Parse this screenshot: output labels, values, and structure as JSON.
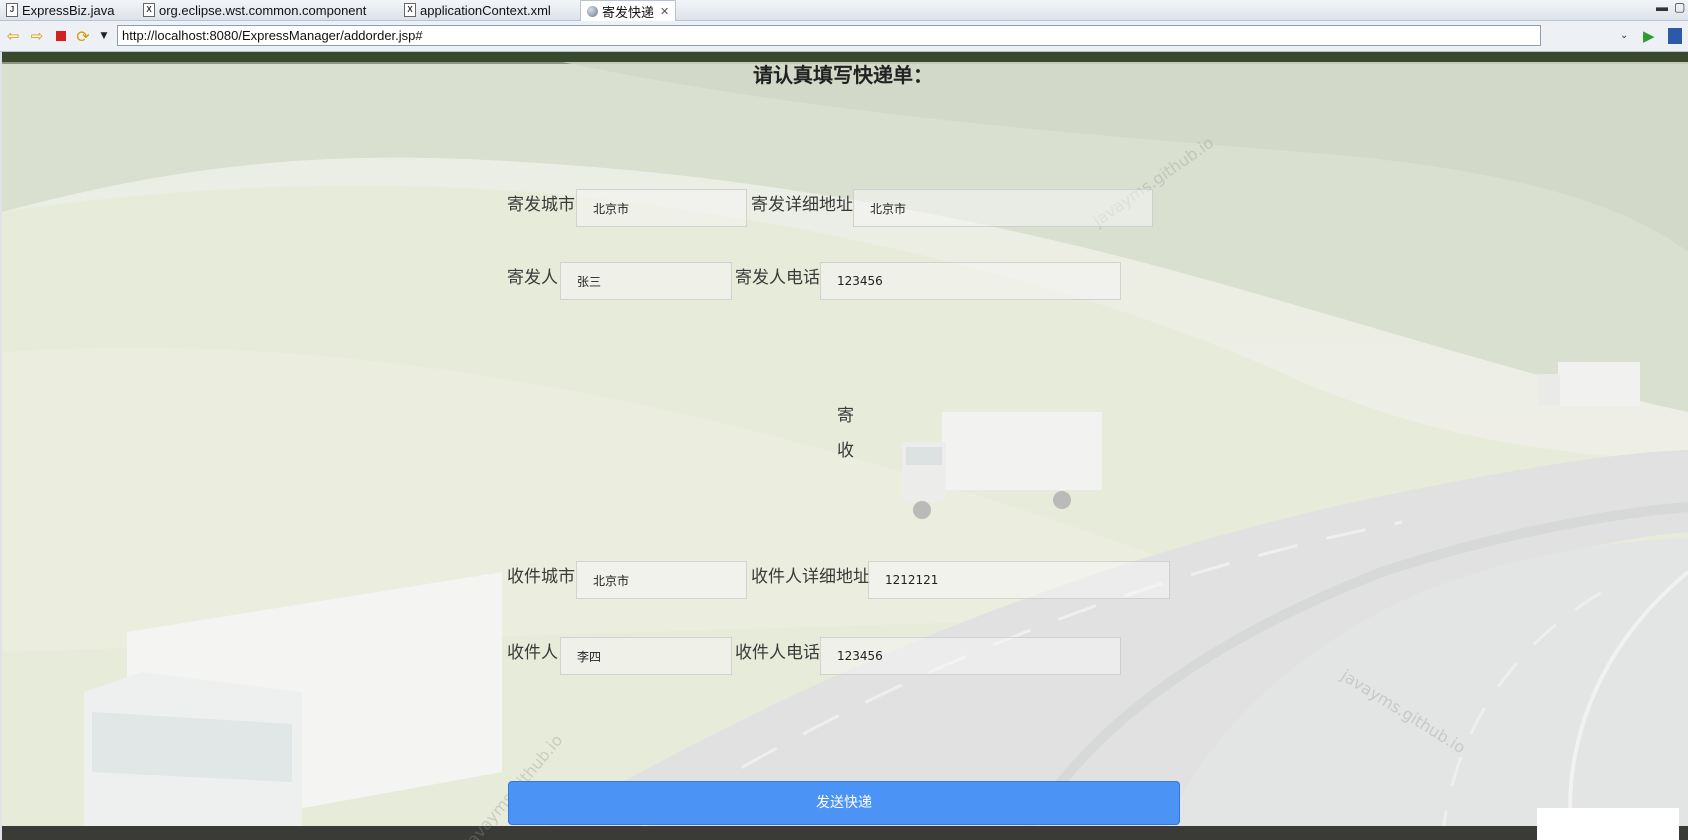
{
  "tabs": [
    {
      "icon": "java-file-icon",
      "label": "ExpressBiz.java",
      "active": false
    },
    {
      "icon": "xml-file-icon",
      "label": "org.eclipse.wst.common.component",
      "active": false
    },
    {
      "icon": "xml-file-icon",
      "label": "applicationContext.xml",
      "active": false
    },
    {
      "icon": "globe-icon",
      "label": "寄发快递",
      "active": true
    }
  ],
  "browser": {
    "url": "http://localhost:8080/ExpressManager/addorder.jsp#"
  },
  "form": {
    "title": "请认真填写快递单：",
    "sender_city_label": "寄发城市",
    "sender_city_value": "北京市",
    "sender_address_label": "寄发详细地址",
    "sender_address_value": "北京市",
    "sender_name_label": "寄发人",
    "sender_name_value": "张三",
    "sender_phone_label": "寄发人电话",
    "sender_phone_value": "123456",
    "divider_top": "寄",
    "divider_bottom": "收",
    "receiver_city_label": "收件城市",
    "receiver_city_value": "北京市",
    "receiver_address_label": "收件人详细地址",
    "receiver_address_value": "1212121",
    "receiver_name_label": "收件人",
    "receiver_name_value": "李四",
    "receiver_phone_label": "收件人电话",
    "receiver_phone_value": "123456",
    "submit_label": "发送快递"
  },
  "watermarks": [
    "javayms.github.io",
    "javayms.github.io",
    "javayms.github.io"
  ],
  "colors": {
    "submit_button": "#4b93f4",
    "submit_text": "#ffffff"
  }
}
